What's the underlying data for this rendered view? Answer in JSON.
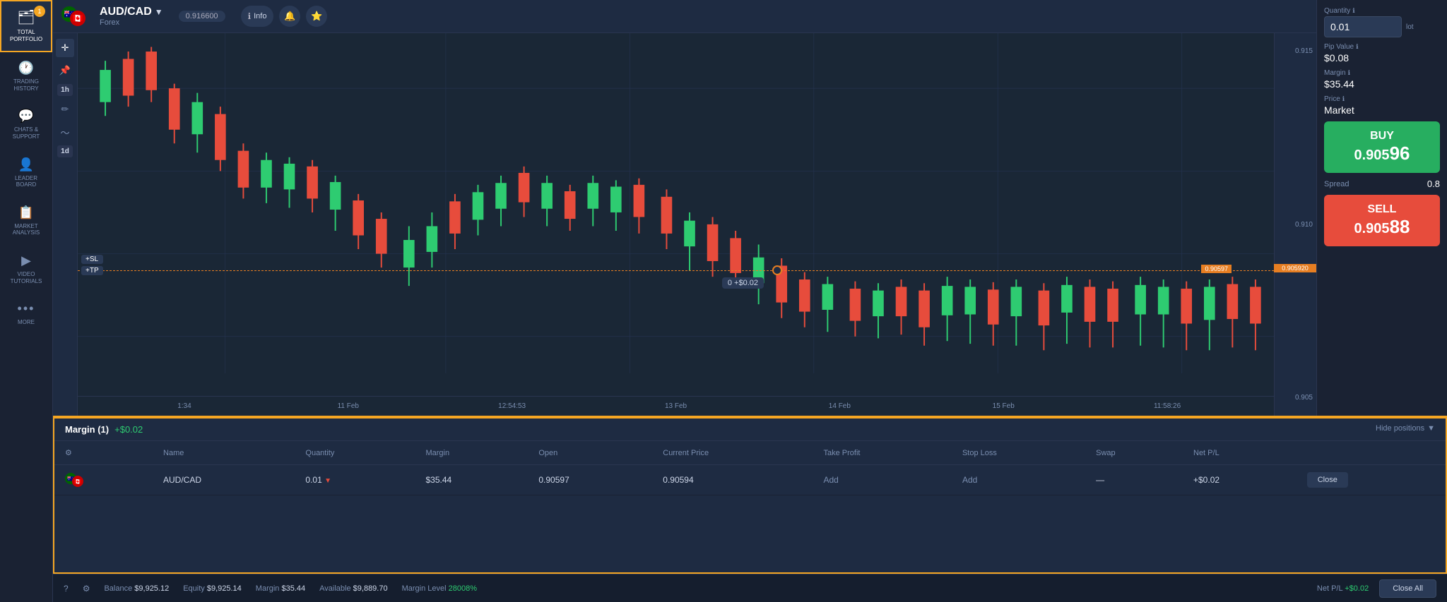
{
  "sidebar": {
    "items": [
      {
        "id": "total-portfolio",
        "label": "TOTAL\nPORTFOLIO",
        "icon": "🗂",
        "active": true,
        "badge": "1"
      },
      {
        "id": "trading-history",
        "label": "TRADING\nHISTORY",
        "icon": "🕐",
        "active": false
      },
      {
        "id": "chats-support",
        "label": "CHATS &\nSUPPORT",
        "icon": "💬",
        "active": false
      },
      {
        "id": "leaderboard",
        "label": "LEADER\nBOARD",
        "icon": "👤",
        "active": false
      },
      {
        "id": "market-analysis",
        "label": "MARKET\nANALYSIS",
        "icon": "📋",
        "active": false
      },
      {
        "id": "video-tutorials",
        "label": "VIDEO\nTUTORIALS",
        "icon": "▶",
        "active": false
      },
      {
        "id": "more",
        "label": "MORE",
        "icon": "•••",
        "active": false
      }
    ]
  },
  "chart": {
    "pair": "AUD/CAD",
    "pair_arrow": "▼",
    "category": "Forex",
    "price_badge": "0.916600",
    "info_label": "Info",
    "time_labels": [
      "1:34",
      "11 Feb",
      "12:54:53",
      "13 Feb",
      "14 Feb",
      "15 Feb",
      "11:58:26"
    ],
    "price_levels": [
      "0.915",
      "0.910",
      "0.905"
    ],
    "current_price": "0.905920",
    "dashed_price": "0.90597",
    "tooltip_text": "0 +$0.02",
    "sl_label": "+SL",
    "tp_label": "+TP",
    "timeframes": [
      "1h",
      "1d"
    ]
  },
  "right_panel": {
    "quantity_label": "Quantity",
    "quantity_info": "ℹ",
    "quantity_value": "0.01",
    "quantity_unit": "lot",
    "pip_label": "Pip Value",
    "pip_info": "ℹ",
    "pip_value": "$0.08",
    "margin_label": "Margin",
    "margin_info": "ℹ",
    "margin_value": "$35.44",
    "price_label": "Price",
    "price_info": "ℹ",
    "price_value": "Market",
    "buy_label": "BUY",
    "buy_price_main": "0.905",
    "buy_price_bold": "96",
    "sell_label": "SELL",
    "sell_price_main": "0.905",
    "sell_price_bold": "88",
    "spread_label": "Spread",
    "spread_value": "0.8"
  },
  "positions": {
    "header": "Margin (1)",
    "header_profit": "+$0.02",
    "hide_label": "Hide positions",
    "columns": [
      "Name",
      "Quantity",
      "Margin",
      "Open",
      "Current Price",
      "Take Profit",
      "Stop Loss",
      "Swap",
      "Net P/L",
      ""
    ],
    "rows": [
      {
        "name": "AUD/CAD",
        "quantity": "0.01",
        "margin": "$35.44",
        "open": "0.90597",
        "current_price": "0.90594",
        "take_profit": "Add",
        "stop_loss": "Add",
        "swap": "—",
        "net_pl": "+$0.02",
        "action": "Close"
      }
    ]
  },
  "status_bar": {
    "help_icon": "?",
    "settings_icon": "⚙",
    "balance_label": "Balance",
    "balance_value": "$9,925.12",
    "equity_label": "Equity",
    "equity_value": "$9,925.14",
    "margin_label": "Margin",
    "margin_value": "$35.44",
    "available_label": "Available",
    "available_value": "$9,889.70",
    "margin_level_label": "Margin Level",
    "margin_level_value": "28008%",
    "net_pl_label": "Net P/L",
    "net_pl_value": "+$0.02",
    "close_all_label": "Close All"
  }
}
